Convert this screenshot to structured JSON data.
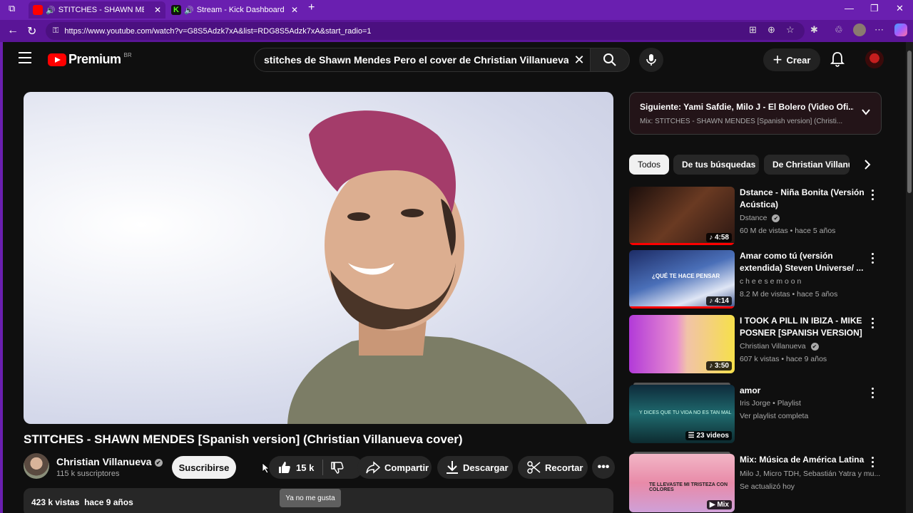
{
  "browser": {
    "tabs": [
      {
        "label": "STITCHES - SHAWN MENDES",
        "active": true
      },
      {
        "label": "Stream - Kick Dashboard",
        "active": false
      }
    ],
    "url": "https://www.youtube.com/watch?v=G8S5Adzk7xA&list=RDG8S5Adzk7xA&start_radio=1",
    "window_controls": {
      "minimize": "—",
      "maximize": "❐",
      "close": "✕"
    }
  },
  "masthead": {
    "logo_text": "Premium",
    "region": "BR",
    "search_query": "stitches de Shawn Mendes Pero el cover de Christian Villanueva",
    "create_label": "Crear"
  },
  "video": {
    "title": "STITCHES - SHAWN MENDES [Spanish version] (Christian Villanueva cover)",
    "channel_name": "Christian Villanueva",
    "channel_verified": "✔",
    "subscribers": "115 k suscriptores",
    "subscribe_label": "Suscribirse",
    "likes": "15 k",
    "share_label": "Compartir",
    "download_label": "Descargar",
    "clip_label": "Recortar",
    "dislike_tooltip": "Ya no me gusta",
    "views": "423 k vistas",
    "age": "hace 9 años"
  },
  "up_next": {
    "title": "Siguiente: Yami Safdie, Milo J - El Bolero (Video Ofi...",
    "subtitle": "Mix: STITCHES - SHAWN MENDES [Spanish version] (Christi..."
  },
  "chips": [
    "Todos",
    "De tus búsquedas",
    "De Christian Villanueva"
  ],
  "recommendations": [
    {
      "title": "Dstance - Niña Bonita (Versión Acústica)",
      "channel": "Dstance",
      "verified": true,
      "meta": "60 M de vistas • hace 5 años",
      "duration": "♪ 4:58",
      "progress": 1.0
    },
    {
      "title": "Amar como tú (versión extendida) Steven Universe/ ...",
      "channel": "c h e e s e m o o n",
      "verified": false,
      "meta": "8.2 M de vistas • hace 5 años",
      "duration": "♪ 4:14",
      "progress": 1.0,
      "thumb_text": "¿QUÉ TE HACE PENSAR"
    },
    {
      "title": "I TOOK A PILL IN IBIZA - MIKE POSNER [SPANISH VERSION] ...",
      "channel": "Christian Villanueva",
      "verified": true,
      "meta": "607 k vistas • hace 9 años",
      "duration": "♪ 3:50",
      "progress": 0
    },
    {
      "title": "amor",
      "channel": "Iris Jorge • Playlist",
      "verified": false,
      "meta": "Ver playlist completa",
      "duration": "☰ 23 videos",
      "progress": 0,
      "thumb_text": "Y DICES QUE TU VIDA NO ES TAN MAL"
    },
    {
      "title": "Mix: Música de América Latina",
      "channel": "Milo J, Micro TDH, Sebastián Yatra y mu...",
      "verified": false,
      "meta": "Se actualizó hoy",
      "duration": "▶ Mix",
      "progress": 0,
      "thumb_text": "TE LLEVASTE MI TRISTEZA CON COLORES"
    }
  ]
}
